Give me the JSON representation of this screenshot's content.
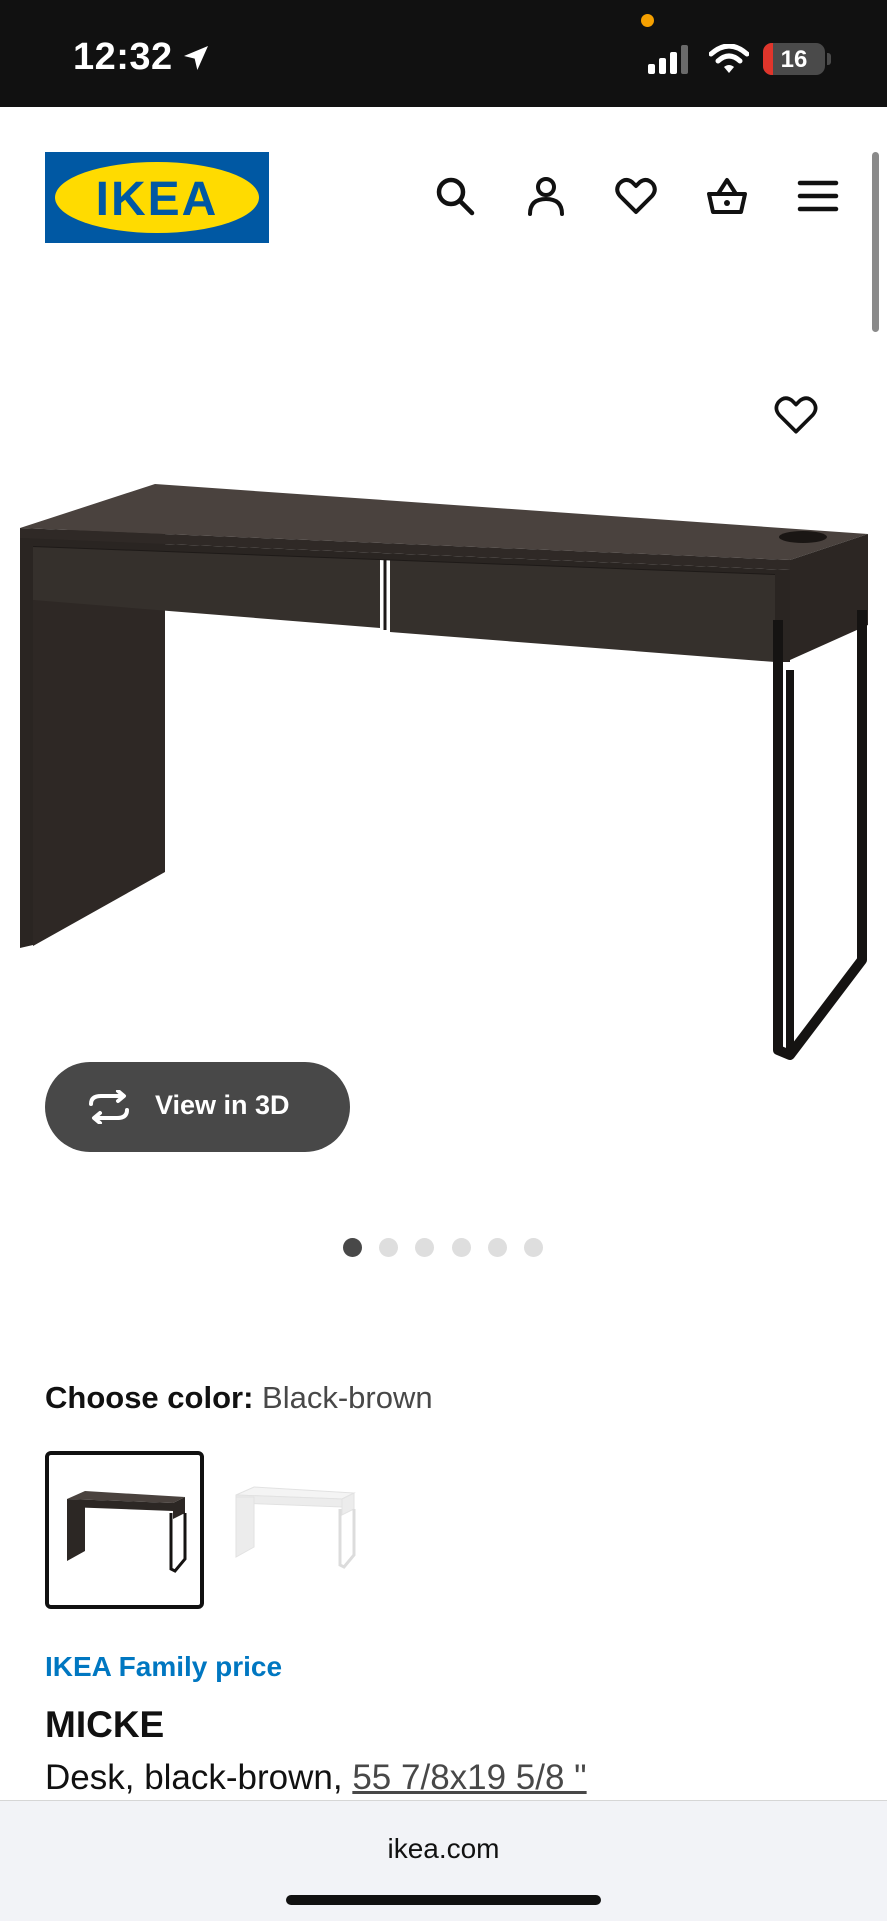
{
  "status_bar": {
    "time": "12:32",
    "battery_level": "16",
    "icons": [
      "location-arrow-icon",
      "signal-icon",
      "wifi-icon",
      "battery-icon"
    ]
  },
  "header": {
    "logo_text": "IKEA",
    "brand_colors": {
      "blue": "#0058a3",
      "yellow": "#ffdb00"
    },
    "icons": [
      "search-icon",
      "account-icon",
      "favorites-icon",
      "cart-icon",
      "menu-icon"
    ]
  },
  "gallery": {
    "view3d_label": "View in 3D",
    "dot_count": 6,
    "active_dot": 1
  },
  "color_chooser": {
    "label": "Choose color:",
    "value": "Black-brown",
    "options": [
      "Black-brown",
      "White"
    ],
    "selected": "Black-brown"
  },
  "product": {
    "family_price_label": "IKEA Family price",
    "name": "MICKE",
    "desc_prefix": "Desk, black-brown,",
    "dimensions": "55 7/8x19 5/8 \""
  },
  "browser": {
    "url": "ikea.com"
  },
  "colors": {
    "accent_blue": "#0077c1",
    "button_dark": "#484848",
    "desk_color": "#3a3430"
  }
}
